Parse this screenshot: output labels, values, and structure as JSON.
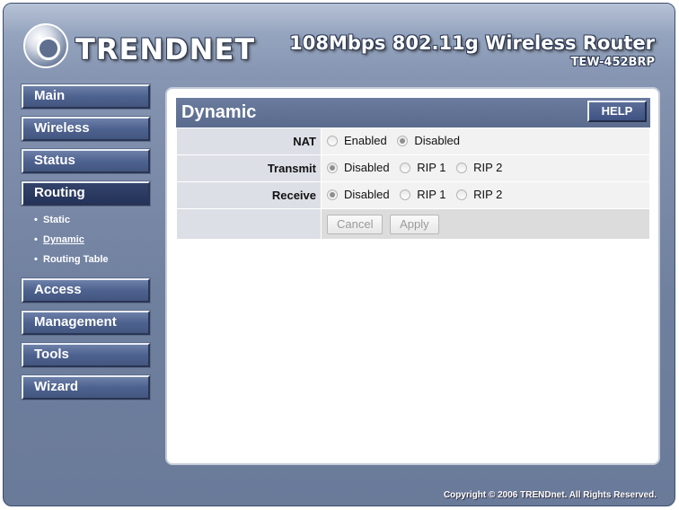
{
  "brand": {
    "logo_text": "TRENDNET",
    "product_title": "108Mbps 802.11g Wireless Router",
    "model": "TEW-452BRP"
  },
  "nav": {
    "items": [
      {
        "label": "Main"
      },
      {
        "label": "Wireless"
      },
      {
        "label": "Status"
      },
      {
        "label": "Routing"
      },
      {
        "label": "Access"
      },
      {
        "label": "Management"
      },
      {
        "label": "Tools"
      },
      {
        "label": "Wizard"
      }
    ],
    "active": "Routing",
    "routing_sub": [
      {
        "label": "Static"
      },
      {
        "label": "Dynamic"
      },
      {
        "label": "Routing Table"
      }
    ]
  },
  "panel": {
    "title": "Dynamic",
    "help_label": "HELP",
    "rows": [
      {
        "label": "NAT",
        "options": [
          "Enabled",
          "Disabled"
        ],
        "selected": "Disabled"
      },
      {
        "label": "Transmit",
        "options": [
          "Disabled",
          "RIP 1",
          "RIP 2"
        ],
        "selected": "Disabled"
      },
      {
        "label": "Receive",
        "options": [
          "Disabled",
          "RIP 1",
          "RIP 2"
        ],
        "selected": "Disabled"
      }
    ],
    "cancel_label": "Cancel",
    "apply_label": "Apply"
  },
  "footer": {
    "copyright": "Copyright © 2006 TRENDnet. All Rights Reserved."
  }
}
